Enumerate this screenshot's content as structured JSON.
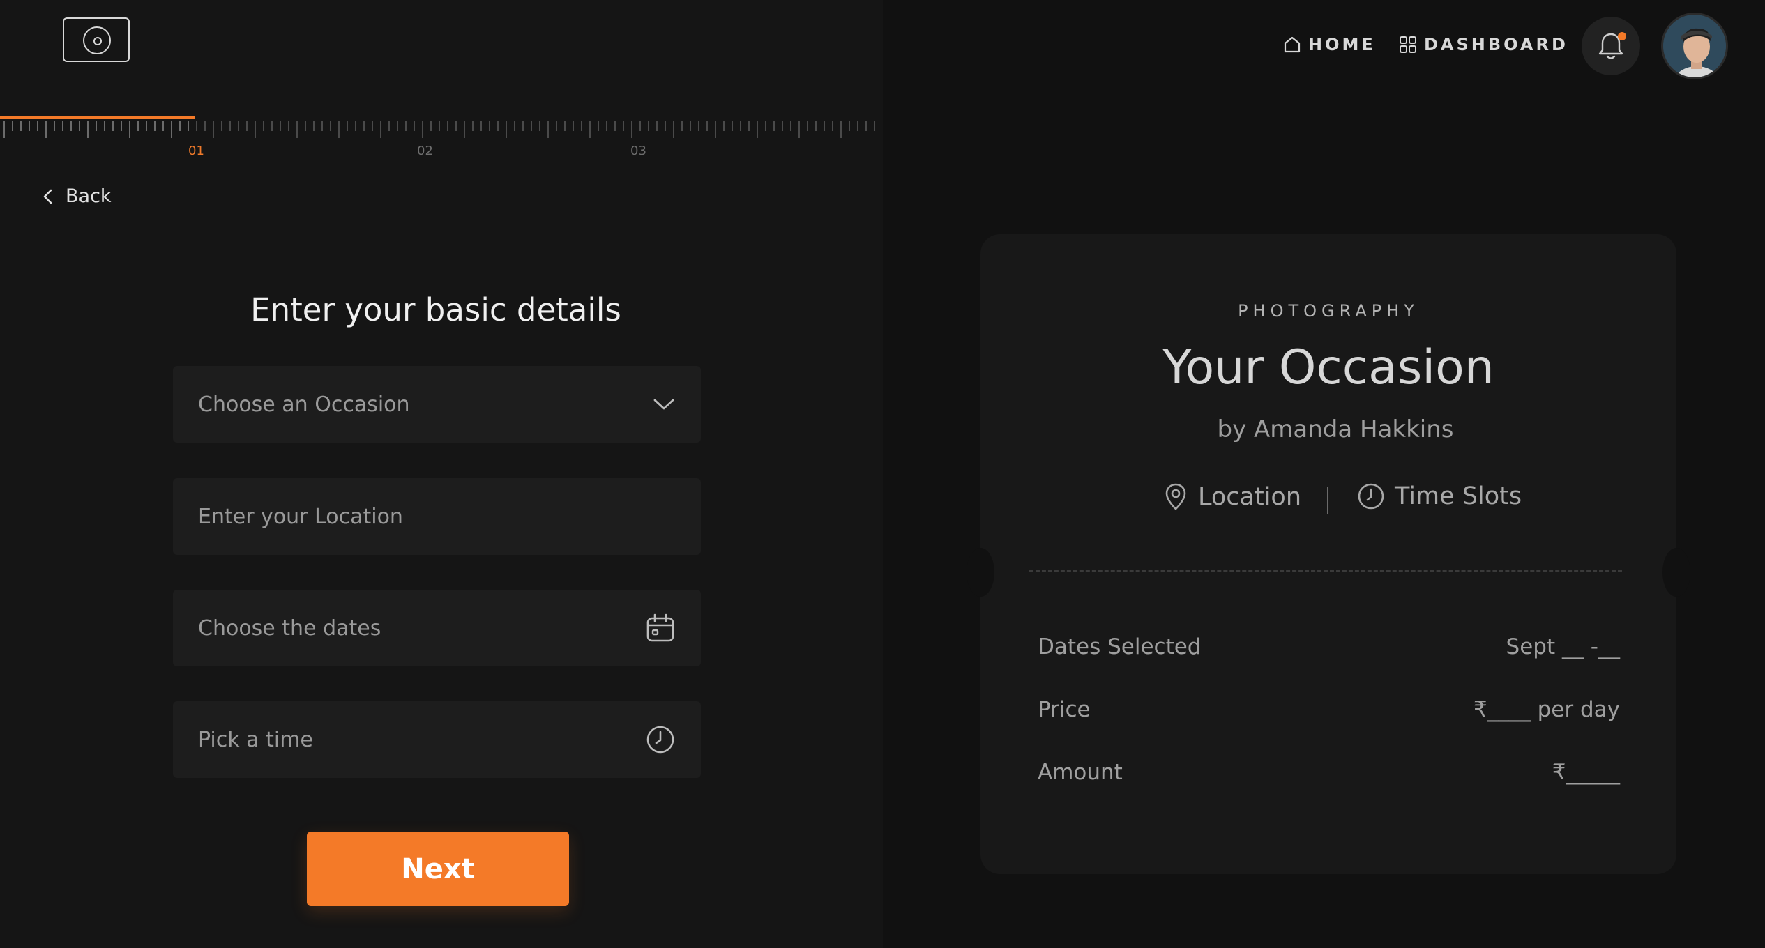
{
  "steps": {
    "labels": [
      "01",
      "02",
      "03"
    ],
    "progress": 0.22
  },
  "back": {
    "label": "Back"
  },
  "form": {
    "title": "Enter your basic details",
    "occasion_label": "Choose an Occasion",
    "location_placeholder": "Enter your Location",
    "dates_label": "Choose the dates",
    "time_label": "Pick a time",
    "next_label": "Next"
  },
  "nav": {
    "home": "HOME",
    "dashboard": "DASHBOARD"
  },
  "card": {
    "category": "PHOTOGRAPHY",
    "title": "Your Occasion",
    "byline": "by Amanda Hakkins",
    "location": "Location",
    "time_slots": "Time Slots",
    "rows": [
      {
        "label": "Dates Selected",
        "value": "Sept __ -__"
      },
      {
        "label": "Price",
        "value": "₹____ per day"
      },
      {
        "label": "Amount",
        "value": "₹_____"
      }
    ]
  },
  "colors": {
    "accent": "#f47a28",
    "panel_dark": "#151515",
    "field_bg": "#1d1d1d"
  },
  "icons": [
    "camera-logo-icon",
    "chevron-left-icon",
    "chevron-down-icon",
    "calendar-icon",
    "clock-icon",
    "home-icon",
    "grid-icon",
    "bell-icon",
    "location-pin-icon"
  ]
}
